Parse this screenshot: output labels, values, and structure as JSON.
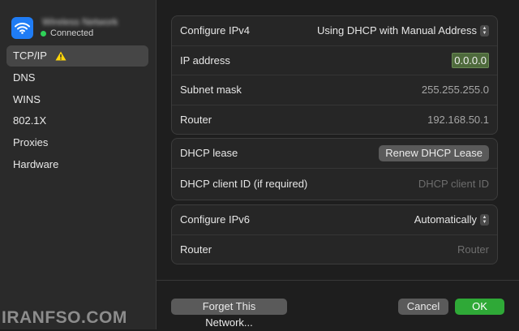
{
  "network": {
    "name": "Wireless Network",
    "status": "Connected"
  },
  "sidebar": {
    "items": [
      {
        "label": "TCP/IP",
        "warning": true
      },
      {
        "label": "DNS"
      },
      {
        "label": "WINS"
      },
      {
        "label": "802.1X"
      },
      {
        "label": "Proxies"
      },
      {
        "label": "Hardware"
      }
    ]
  },
  "ipv4": {
    "configure_label": "Configure IPv4",
    "configure_value": "Using DHCP with Manual Address",
    "ip_label": "IP address",
    "ip_value": "0.0.0.0",
    "subnet_label": "Subnet mask",
    "subnet_value": "255.255.255.0",
    "router_label": "Router",
    "router_value": "192.168.50.1"
  },
  "dhcp": {
    "lease_label": "DHCP lease",
    "renew_button": "Renew DHCP Lease",
    "client_id_label": "DHCP client ID (if required)",
    "client_id_placeholder": "DHCP client ID"
  },
  "ipv6": {
    "configure_label": "Configure IPv6",
    "configure_value": "Automatically",
    "router_label": "Router",
    "router_placeholder": "Router"
  },
  "footer": {
    "forget_button": "Forget This Network...",
    "cancel_button": "Cancel",
    "ok_button": "OK"
  },
  "watermark": "IRANFSO.COM",
  "colors": {
    "accent_blue": "#1f7cf5",
    "ok_green": "#2fa937",
    "status_green": "#2fd158",
    "warning_yellow": "#ffd60a"
  }
}
